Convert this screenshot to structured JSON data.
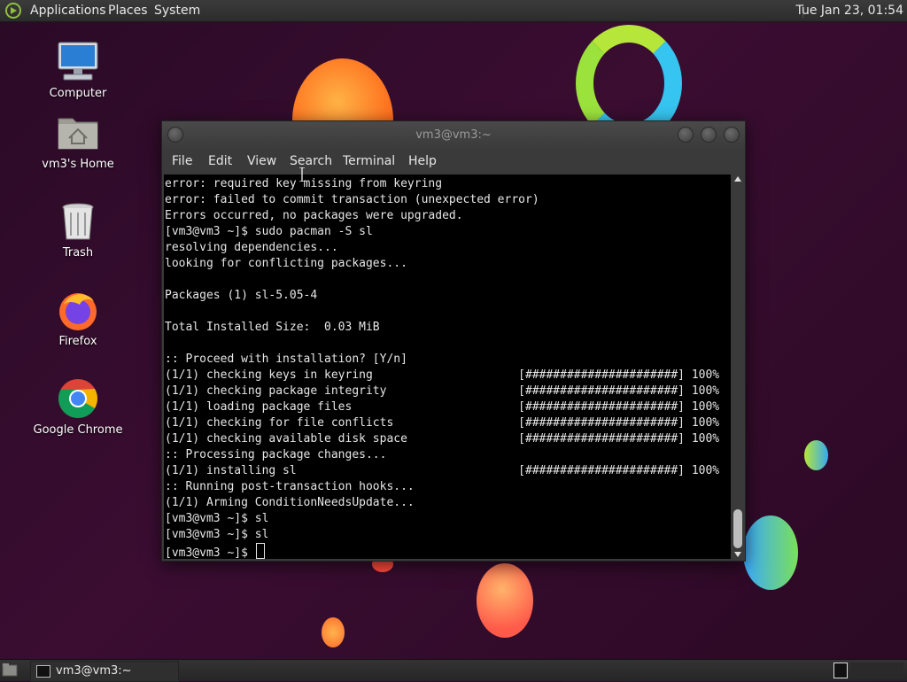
{
  "top_panel": {
    "menus": [
      "Applications",
      "Places",
      "System"
    ],
    "clock": "Tue Jan 23, 01:54"
  },
  "desktop": {
    "icons": [
      {
        "label": "Computer",
        "icon": "computer-icon"
      },
      {
        "label": "vm3's Home",
        "icon": "home-folder-icon"
      },
      {
        "label": "Trash",
        "icon": "trash-icon"
      },
      {
        "label": "Firefox",
        "icon": "firefox-icon"
      },
      {
        "label": "Google Chrome",
        "icon": "chrome-icon"
      }
    ]
  },
  "window": {
    "title": "vm3@vm3:~",
    "menu": [
      "File",
      "Edit",
      "View",
      "Search",
      "Terminal",
      "Help"
    ],
    "terminal_lines": [
      "error: required key missing from keyring",
      "error: failed to commit transaction (unexpected error)",
      "Errors occurred, no packages were upgraded.",
      "[vm3@vm3 ~]$ sudo pacman -S sl",
      "resolving dependencies...",
      "looking for conflicting packages...",
      "",
      "Packages (1) sl-5.05-4",
      "",
      "Total Installed Size:  0.03 MiB",
      "",
      ":: Proceed with installation? [Y/n]",
      "(1/1) checking keys in keyring                     [######################] 100%",
      "(1/1) checking package integrity                   [######################] 100%",
      "(1/1) loading package files                        [######################] 100%",
      "(1/1) checking for file conflicts                  [######################] 100%",
      "(1/1) checking available disk space                [######################] 100%",
      ":: Processing package changes...",
      "(1/1) installing sl                                [######################] 100%",
      ":: Running post-transaction hooks...",
      "(1/1) Arming ConditionNeedsUpdate...",
      "[vm3@vm3 ~]$ sl",
      "[vm3@vm3 ~]$ sl"
    ],
    "prompt": "[vm3@vm3 ~]$ "
  },
  "taskbar": {
    "task_label": "vm3@vm3:~"
  }
}
